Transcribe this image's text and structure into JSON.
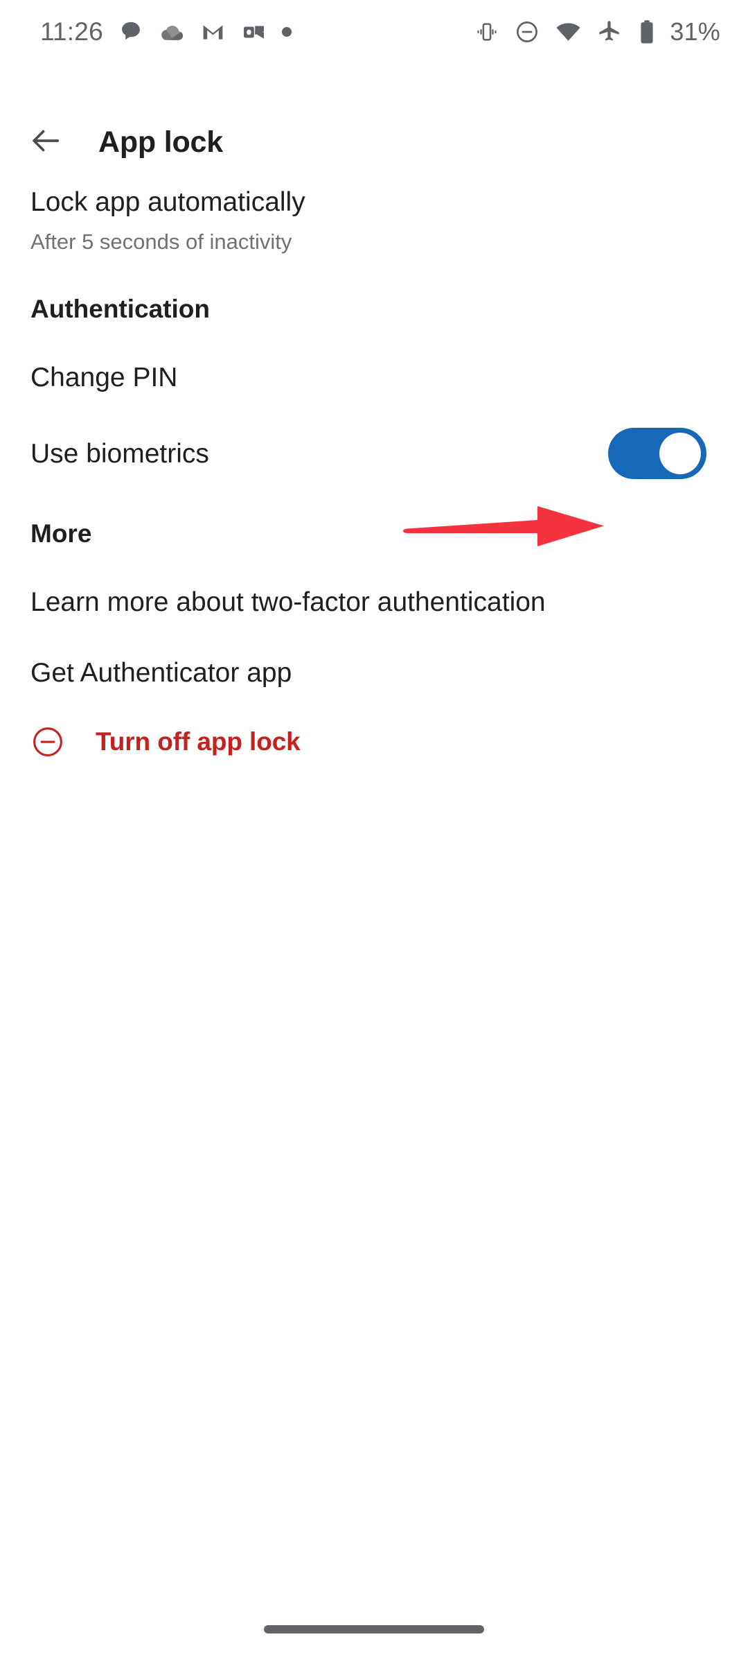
{
  "statusbar": {
    "time": "11:26",
    "battery_text": "31%",
    "left_icons": [
      "chat-bubble-icon",
      "cloud-icon",
      "gmail-icon",
      "outlook-icon",
      "dot-icon"
    ],
    "right_icons": [
      "vibrate-icon",
      "do-not-disturb-icon",
      "wifi-icon",
      "airplane-mode-icon",
      "battery-icon"
    ]
  },
  "header": {
    "back_icon": "arrow-back-icon",
    "title": "App lock"
  },
  "settings": {
    "auto_lock": {
      "title": "Lock app automatically",
      "subtitle": "After 5 seconds of inactivity"
    },
    "authentication_header": "Authentication",
    "change_pin": "Change PIN",
    "use_biometrics": {
      "label": "Use biometrics",
      "toggle_state": "on"
    },
    "more_header": "More",
    "learn_more": "Learn more about two-factor authentication",
    "get_authenticator": "Get Authenticator app",
    "turn_off": {
      "label": "Turn off app lock",
      "icon": "minus-circle-icon"
    }
  },
  "annotation": {
    "arrow": "red-arrow-pointing-right",
    "target": "use-biometrics-toggle"
  },
  "colors": {
    "toggle_on": "#1769b8",
    "danger": "#c5221f",
    "annotation_red": "#f5333f",
    "status_icon": "#5f6368",
    "text_primary": "#1f1f1f",
    "text_secondary": "#6e7276",
    "background": "#ffffff"
  },
  "navigation": {
    "gesture_pill": "home-gesture-bar"
  }
}
